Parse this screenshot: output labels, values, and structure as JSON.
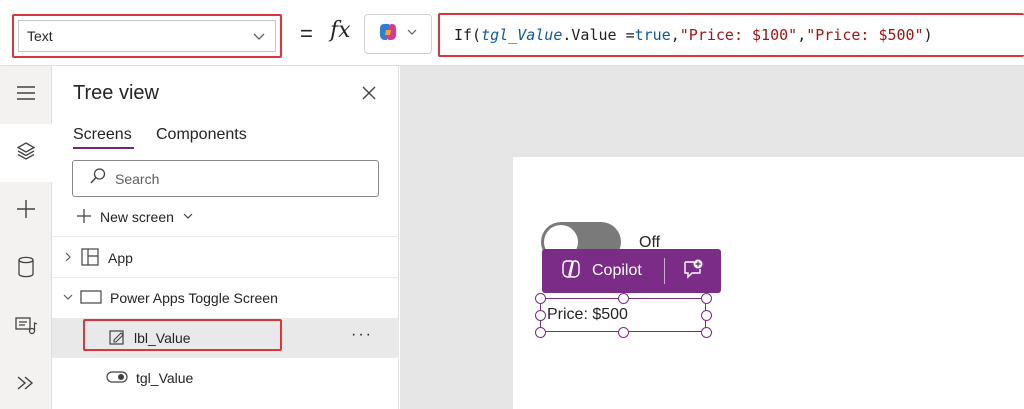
{
  "formula_bar": {
    "property": "Text",
    "equals": "=",
    "fx": "fx",
    "formula": {
      "fn": "If(",
      "control": "tgl_Value",
      "prop": ".Value = ",
      "kw": "true",
      "sep1": ", ",
      "str1": "\"Price: $100\"",
      "sep2": ", ",
      "str2": "\"Price: $500\"",
      "close": ")"
    }
  },
  "tree_view": {
    "title": "Tree view",
    "tabs": [
      {
        "label": "Screens",
        "active": true
      },
      {
        "label": "Components",
        "active": false
      }
    ],
    "search_placeholder": "Search",
    "new_screen_label": "New screen",
    "nodes": {
      "app": "App",
      "screen": "Power Apps Toggle Screen",
      "label_control": "lbl_Value",
      "toggle_control": "tgl_Value"
    },
    "more_label": "···"
  },
  "canvas": {
    "toggle_state_label": "Off",
    "copilot_label": "Copilot",
    "label_text": "Price: $500"
  },
  "colors": {
    "accent": "#7b2c87",
    "highlight": "#d9363e"
  },
  "icons": {
    "rail": [
      "hamburger-icon",
      "layers-icon",
      "plus-icon",
      "database-icon",
      "media-icon",
      "power-automate-icon"
    ]
  }
}
